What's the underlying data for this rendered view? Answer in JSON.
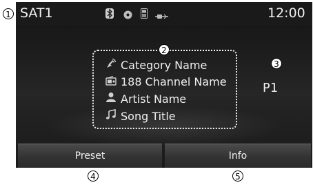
{
  "status_bar": {
    "source_label": "SAT1",
    "clock": "12:00",
    "icons": [
      "bluetooth-icon",
      "disc-icon",
      "phone-icon",
      "usb-icon"
    ]
  },
  "now_playing": {
    "category": "Category Name",
    "channel": "188 Channel Name",
    "artist": "Artist Name",
    "song": "Song Title"
  },
  "preset_label": "P1",
  "buttons": {
    "preset": "Preset",
    "info": "Info"
  },
  "callouts": {
    "c1": "1",
    "c2": "2",
    "c3": "3",
    "c4": "4",
    "c5": "5"
  }
}
